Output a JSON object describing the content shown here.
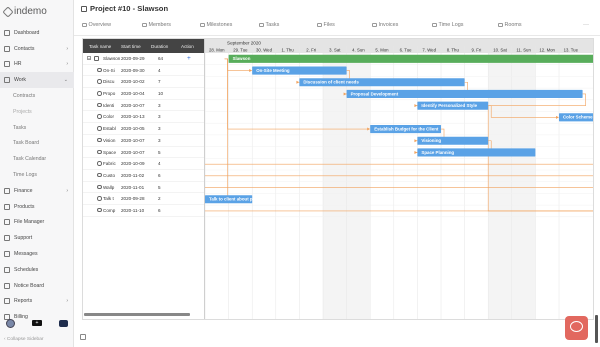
{
  "app": {
    "logo": "indemo"
  },
  "sidebar": {
    "items": [
      {
        "label": "Dashboard",
        "icon": "dashboard-icon",
        "chevron": "",
        "type": "main"
      },
      {
        "label": "Contacts",
        "icon": "contacts-icon",
        "chevron": "›",
        "type": "main"
      },
      {
        "label": "HR",
        "icon": "hr-icon",
        "chevron": "›",
        "type": "main"
      },
      {
        "label": "Work",
        "icon": "work-icon",
        "chevron": "⌄",
        "type": "main active"
      },
      {
        "label": "Contracts",
        "icon": "",
        "chevron": "",
        "type": "sub"
      },
      {
        "label": "Projects",
        "icon": "",
        "chevron": "",
        "type": "sub sel"
      },
      {
        "label": "Tasks",
        "icon": "",
        "chevron": "",
        "type": "sub"
      },
      {
        "label": "Task Board",
        "icon": "",
        "chevron": "",
        "type": "sub"
      },
      {
        "label": "Task Calendar",
        "icon": "",
        "chevron": "",
        "type": "sub"
      },
      {
        "label": "Time Logs",
        "icon": "",
        "chevron": "",
        "type": "sub"
      },
      {
        "label": "Finance",
        "icon": "finance-icon",
        "chevron": "›",
        "type": "main"
      },
      {
        "label": "Products",
        "icon": "products-icon",
        "chevron": "",
        "type": "main"
      },
      {
        "label": "File Manager",
        "icon": "file-manager-icon",
        "chevron": "",
        "type": "main"
      },
      {
        "label": "Support",
        "icon": "support-icon",
        "chevron": "",
        "type": "main"
      },
      {
        "label": "Messages",
        "icon": "messages-icon",
        "chevron": "",
        "type": "main"
      },
      {
        "label": "Schedules",
        "icon": "schedules-icon",
        "chevron": "",
        "type": "main"
      },
      {
        "label": "Notice Board",
        "icon": "notice-board-icon",
        "chevron": "",
        "type": "main"
      },
      {
        "label": "Reports",
        "icon": "reports-icon",
        "chevron": "›",
        "type": "main"
      },
      {
        "label": "Billing",
        "icon": "billing-icon",
        "chevron": "",
        "type": "main"
      }
    ],
    "add_label": "+",
    "collapse_label": "‹ Collapse Sidebar"
  },
  "header": {
    "title": "Project #10 - Slawson",
    "tabs": [
      {
        "label": "Overview",
        "icon": "overview-icon"
      },
      {
        "label": "Members",
        "icon": "members-icon"
      },
      {
        "label": "Milestones",
        "icon": "milestones-icon"
      },
      {
        "label": "Tasks",
        "icon": "tasks-icon"
      },
      {
        "label": "Files",
        "icon": "files-icon"
      },
      {
        "label": "Invoices",
        "icon": "invoices-icon"
      },
      {
        "label": "Time Logs",
        "icon": "time-logs-icon"
      },
      {
        "label": "Rooms",
        "icon": "rooms-icon"
      }
    ],
    "more": "···"
  },
  "gantt": {
    "columns": {
      "name": "Task name",
      "start": "Start time",
      "duration": "Duration",
      "action": "Action"
    },
    "month": "September 2020",
    "days": [
      "28. Mon",
      "29. Tue",
      "30. Wed",
      "1. Thu",
      "2. Fri",
      "3. Sat",
      "4. Sun",
      "5. Mon",
      "6. Tue",
      "7. Wed",
      "8. Thu",
      "9. Fri",
      "10. Sat",
      "11. Sun",
      "12. Mon",
      "13. Tue"
    ],
    "weekend_days": [
      5,
      6,
      12,
      13
    ],
    "rows": [
      {
        "name": "Slawson",
        "start": "2020-09-29",
        "duration": "64",
        "bar": "Slawson",
        "bar_from": 1.0,
        "bar_to": 16.5,
        "color": "#58ad5b"
      },
      {
        "name": "On-Si",
        "start": "2020-09-30",
        "duration": "4",
        "bar": "On-Site Meeting",
        "bar_from": 2.0,
        "bar_to": 6.0,
        "color": "#5aa2e6"
      },
      {
        "name": "Discu",
        "start": "2020-10-02",
        "duration": "7",
        "bar": "Discussion of client needs",
        "bar_from": 4.0,
        "bar_to": 11.0,
        "color": "#5aa2e6"
      },
      {
        "name": "Propo",
        "start": "2020-10-04",
        "duration": "10",
        "bar": "Proposal Development",
        "bar_from": 6.0,
        "bar_to": 16.0,
        "color": "#5aa2e6"
      },
      {
        "name": "Identi",
        "start": "2020-10-07",
        "duration": "3",
        "bar": "Identify Personalized Style",
        "bar_from": 9.0,
        "bar_to": 12.0,
        "color": "#5aa2e6"
      },
      {
        "name": "Color",
        "start": "2020-10-13",
        "duration": "3",
        "bar": "Color Scheme",
        "bar_from": 15.0,
        "bar_to": 18.0,
        "color": "#5aa2e6"
      },
      {
        "name": "Establ",
        "start": "2020-10-05",
        "duration": "3",
        "bar": "Establish Budget for the Client",
        "bar_from": 7.0,
        "bar_to": 10.0,
        "color": "#5aa2e6"
      },
      {
        "name": "Vision",
        "start": "2020-10-07",
        "duration": "3",
        "bar": "Visioning",
        "bar_from": 9.0,
        "bar_to": 12.0,
        "color": "#5aa2e6"
      },
      {
        "name": "Space",
        "start": "2020-10-07",
        "duration": "5",
        "bar": "Space Planning",
        "bar_from": 9.0,
        "bar_to": 14.0,
        "color": "#5aa2e6"
      },
      {
        "name": "Fabric",
        "start": "2020-10-09",
        "duration": "4",
        "bar": "",
        "bar_from": null,
        "bar_to": null,
        "color": "#5aa2e6"
      },
      {
        "name": "Custo",
        "start": "2020-11-02",
        "duration": "6",
        "bar": "",
        "bar_from": null,
        "bar_to": null,
        "color": "#5aa2e6"
      },
      {
        "name": "Wallp",
        "start": "2020-11-01",
        "duration": "5",
        "bar": "",
        "bar_from": null,
        "bar_to": null,
        "color": "#5aa2e6"
      },
      {
        "name": "Talk t",
        "start": "2020-09-28",
        "duration": "2",
        "bar": "Talk to client about p",
        "bar_from": 0.0,
        "bar_to": 2.0,
        "color": "#5aa2e6"
      },
      {
        "name": "Comp",
        "start": "2020-11-10",
        "duration": "6",
        "bar": "",
        "bar_from": null,
        "bar_to": null,
        "color": "#5aa2e6"
      }
    ],
    "add_label": "+"
  }
}
